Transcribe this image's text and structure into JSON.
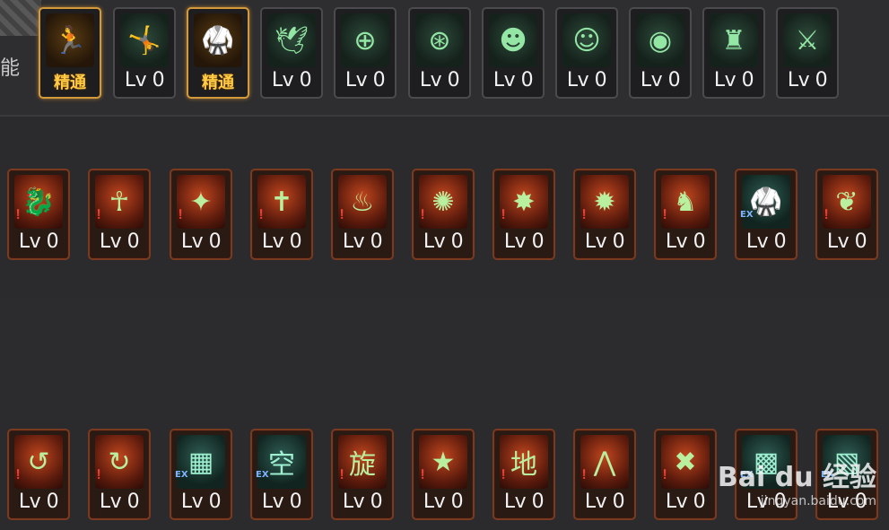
{
  "header": {
    "label": "能"
  },
  "rows": [
    {
      "slots": [
        {
          "style": "gold",
          "icon": "dash-figure-icon",
          "glyph": "🏃",
          "level": "精通"
        },
        {
          "style": "green",
          "icon": "leap-figure-icon",
          "glyph": "🤸",
          "level": "Lv 0"
        },
        {
          "style": "gold",
          "icon": "strike-figure-icon",
          "glyph": "🥋",
          "level": "精通"
        },
        {
          "style": "green",
          "icon": "wings-icon",
          "glyph": "🕊",
          "level": "Lv 0"
        },
        {
          "style": "green",
          "icon": "crosshair-icon",
          "glyph": "⊕",
          "level": "Lv 0"
        },
        {
          "style": "green",
          "icon": "crosshair-gear-icon",
          "glyph": "⊛",
          "level": "Lv 0"
        },
        {
          "style": "green",
          "icon": "head-profile-icon",
          "glyph": "☻",
          "level": "Lv 0"
        },
        {
          "style": "green",
          "icon": "head-gear-icon",
          "glyph": "☺",
          "level": "Lv 0"
        },
        {
          "style": "green",
          "icon": "eye-icon",
          "glyph": "◉",
          "level": "Lv 0"
        },
        {
          "style": "green",
          "icon": "muscle-figure-icon",
          "glyph": "♜",
          "level": "Lv 0"
        },
        {
          "style": "green",
          "icon": "sword-figure-icon",
          "glyph": "⚔",
          "level": "Lv 0"
        }
      ]
    },
    {
      "slots": [
        {
          "style": "red",
          "icon": "dragon-icon",
          "glyph": "🐉",
          "tag": "❗",
          "level": "Lv 0"
        },
        {
          "style": "red",
          "icon": "ankh-icon",
          "glyph": "☥",
          "tag": "❗",
          "level": "Lv 0"
        },
        {
          "style": "red",
          "icon": "slash-icon",
          "glyph": "✦",
          "tag": "❗",
          "level": "Lv 0"
        },
        {
          "style": "red",
          "icon": "cross-icon",
          "glyph": "✝",
          "tag": "❗",
          "level": "Lv 0"
        },
        {
          "style": "red",
          "icon": "flame-crest-icon",
          "glyph": "♨",
          "tag": "❗",
          "level": "Lv 0"
        },
        {
          "style": "red",
          "icon": "vortex-icon",
          "glyph": "✺",
          "tag": "❗",
          "level": "Lv 0"
        },
        {
          "style": "red",
          "icon": "claw-icon",
          "glyph": "✸",
          "tag": "❗",
          "level": "Lv 0"
        },
        {
          "style": "red",
          "icon": "burst-icon",
          "glyph": "✹",
          "tag": "❗",
          "level": "Lv 0"
        },
        {
          "style": "red",
          "icon": "beast-icon",
          "glyph": "♞",
          "tag": "❗",
          "level": "Lv 0"
        },
        {
          "style": "red",
          "icon": "ex-figure-icon",
          "glyph": "🥋",
          "tag": "EX",
          "teal": true,
          "level": "Lv 0"
        },
        {
          "style": "red",
          "icon": "wing-slash-icon",
          "glyph": "❦",
          "tag": "❗",
          "level": "Lv 0"
        }
      ]
    },
    {
      "slots": [
        {
          "style": "red",
          "icon": "spin-strike-icon",
          "glyph": "↺",
          "tag": "❗",
          "level": "Lv 0"
        },
        {
          "style": "red",
          "icon": "swirl-icon",
          "glyph": "↻",
          "tag": "❗",
          "level": "Lv 0"
        },
        {
          "style": "red",
          "icon": "ex-card-icon",
          "glyph": "▦",
          "tag": "EX",
          "teal": true,
          "level": "Lv 0"
        },
        {
          "style": "red",
          "icon": "kanji-sky-icon",
          "glyph": "空",
          "tag": "EX",
          "teal": true,
          "level": "Lv 0"
        },
        {
          "style": "red",
          "icon": "kanji-wind-icon",
          "glyph": "旋",
          "tag": "❗",
          "level": "Lv 0"
        },
        {
          "style": "red",
          "icon": "star-burst-icon",
          "glyph": "★",
          "tag": "❗",
          "level": "Lv 0"
        },
        {
          "style": "red",
          "icon": "kanji-earth-icon",
          "glyph": "地",
          "tag": "❗",
          "level": "Lv 0"
        },
        {
          "style": "red",
          "icon": "spikes-icon",
          "glyph": "⋀",
          "tag": "❗",
          "level": "Lv 0"
        },
        {
          "style": "red",
          "icon": "x-cross-icon",
          "glyph": "✖",
          "tag": "❗",
          "level": "Lv 0"
        },
        {
          "style": "red",
          "icon": "ex-card-icon-2",
          "glyph": "▩",
          "tag": "EX",
          "teal": true,
          "level": "Lv 0"
        },
        {
          "style": "red",
          "icon": "ex-card-icon-3",
          "glyph": "▧",
          "tag": "EX",
          "teal": true,
          "level": "Lv 0"
        }
      ]
    }
  ],
  "watermark": {
    "logo": "Bai du 经验",
    "url": "jingyan.baidu.com"
  }
}
